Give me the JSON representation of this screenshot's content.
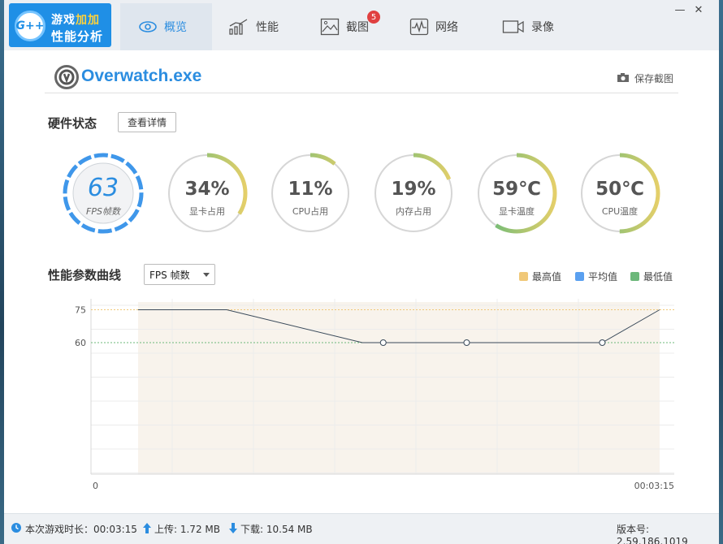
{
  "brand": {
    "badge_text": "G++",
    "title_line1_a": "游戏",
    "title_line1_b": "加加",
    "title_line2": "性能分析"
  },
  "tabs": [
    {
      "label": "概览",
      "icon": "eye-icon",
      "active": true
    },
    {
      "label": "性能",
      "icon": "performance-chart-icon",
      "active": false
    },
    {
      "label": "截图",
      "icon": "image-icon",
      "active": false,
      "badge": "5"
    },
    {
      "label": "网络",
      "icon": "network-pulse-icon",
      "active": false
    },
    {
      "label": "录像",
      "icon": "video-camera-icon",
      "active": false
    }
  ],
  "window_controls": {
    "minimize": "—",
    "close": "✕"
  },
  "app": {
    "name": "Overwatch.exe",
    "save_screenshot": "保存截图"
  },
  "hardware": {
    "title": "硬件状态",
    "detail_button": "查看详情",
    "gauges": [
      {
        "value": "63",
        "label": "FPS帧数",
        "percent": 100,
        "kind": "fps"
      },
      {
        "value": "34%",
        "label": "显卡占用",
        "percent": 34,
        "kind": "ring"
      },
      {
        "value": "11%",
        "label": "CPU占用",
        "percent": 11,
        "kind": "ring"
      },
      {
        "value": "19%",
        "label": "内存占用",
        "percent": 19,
        "kind": "ring"
      },
      {
        "value": "59℃",
        "label": "显卡温度",
        "percent": 59,
        "kind": "ring"
      },
      {
        "value": "50℃",
        "label": "CPU温度",
        "percent": 50,
        "kind": "ring"
      }
    ]
  },
  "curve": {
    "title": "性能参数曲线",
    "select_value": "FPS 帧数",
    "legend": [
      {
        "label": "最高值",
        "color": "#f0c878"
      },
      {
        "label": "平均值",
        "color": "#5aa0f0"
      },
      {
        "label": "最低值",
        "color": "#6cb87a"
      }
    ]
  },
  "chart_data": {
    "type": "line",
    "y_ticks": [
      "75",
      "60"
    ],
    "x_start_label": "0",
    "x_end_label": "00:03:15",
    "ylim": [
      0,
      80
    ],
    "x": [
      0,
      0.17,
      0.43,
      0.47,
      0.63,
      0.89,
      1.0
    ],
    "values": [
      75,
      75,
      60,
      60,
      60,
      60,
      75
    ],
    "markers_at_index": [
      3,
      4,
      5
    ],
    "max_line": 75,
    "min_line": 60
  },
  "footer": {
    "duration_label": "本次游戏时长：00:03:15",
    "upload_label": "上传: 1.72 MB",
    "download_label": "下载: 10.54 MB",
    "version_label": "版本号: 2.59.186.1019"
  }
}
